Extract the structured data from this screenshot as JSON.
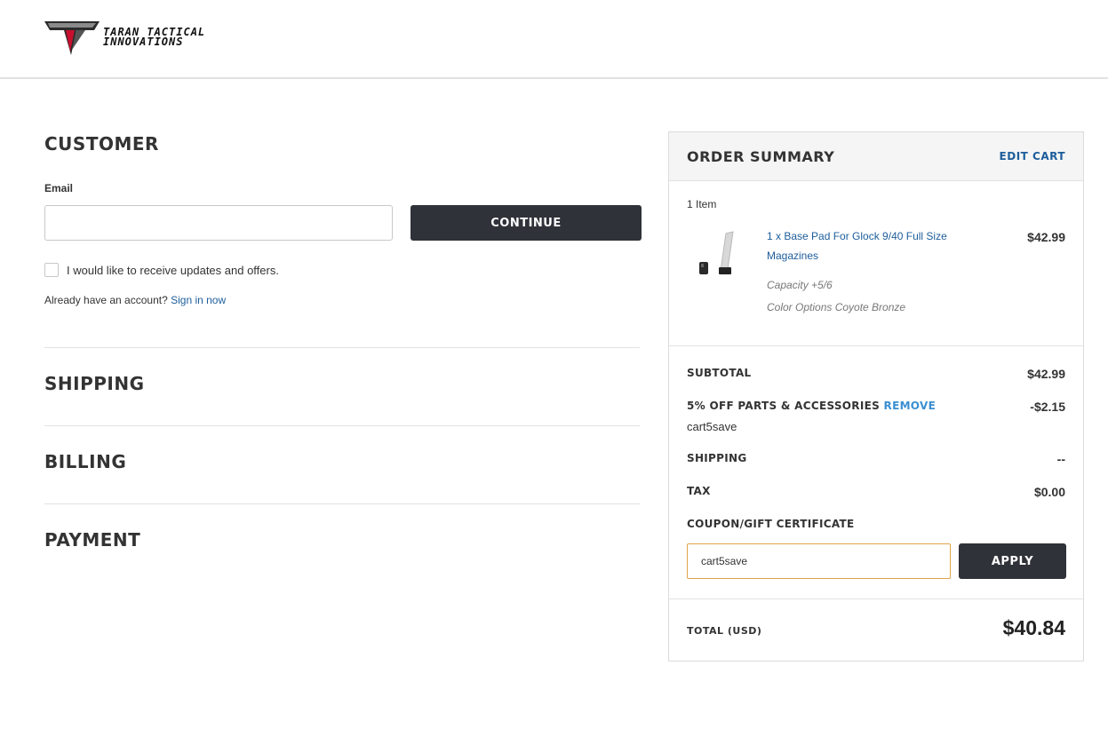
{
  "brand": {
    "line1": "Taran Tactical",
    "line2": "Innovations",
    "logo_icon": "taran-tactical-logo-icon"
  },
  "customer": {
    "title": "CUSTOMER",
    "email_label": "Email",
    "email_value": "",
    "continue_label": "CONTINUE",
    "updates_label": "I would like to receive updates and offers.",
    "account_prompt": "Already have an account?",
    "sign_in_label": "Sign in now"
  },
  "sections": {
    "shipping": "SHIPPING",
    "billing": "BILLING",
    "payment": "PAYMENT"
  },
  "summary": {
    "title": "ORDER SUMMARY",
    "edit_cart": "EDIT CART",
    "item_count": "1 Item",
    "item": {
      "name": "1 x Base Pad For Glock 9/40 Full Size Magazines",
      "price": "$42.99",
      "option1": "Capacity +5/6",
      "option2": "Color Options Coyote Bronze"
    },
    "subtotal_label": "SUBTOTAL",
    "subtotal_value": "$42.99",
    "discount_label": "5% OFF PARTS & ACCESSORIES",
    "remove_label": "REMOVE",
    "discount_value": "-$2.15",
    "discount_code": "cart5save",
    "shipping_label": "SHIPPING",
    "shipping_value": "--",
    "tax_label": "TAX",
    "tax_value": "$0.00",
    "coupon_label": "COUPON/GIFT CERTIFICATE",
    "coupon_value": "cart5save",
    "apply_label": "APPLY",
    "total_label": "TOTAL (USD)",
    "total_value": "$40.84"
  },
  "colors": {
    "link": "#1d5d9b",
    "button": "#2f3238",
    "coupon_border": "#e0a44c"
  }
}
